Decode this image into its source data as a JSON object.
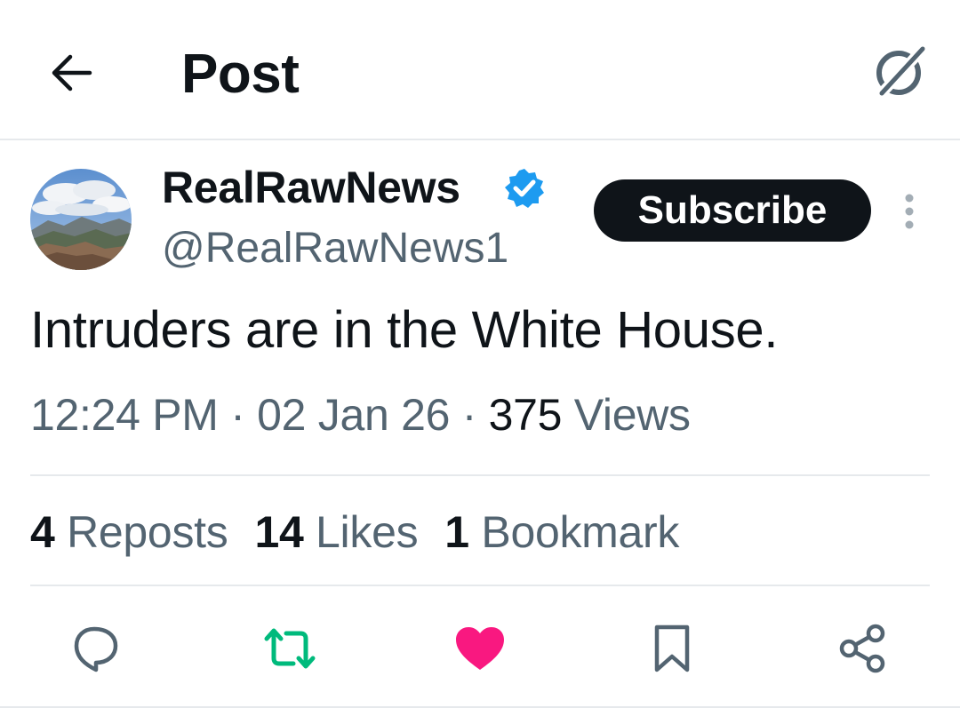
{
  "header": {
    "title": "Post"
  },
  "author": {
    "display_name": "RealRawNews",
    "handle": "@RealRawNews1",
    "verified": true,
    "subscribe_label": "Subscribe"
  },
  "post": {
    "text": "Intruders are in the White House.",
    "time": "12:24 PM",
    "date": "02 Jan 26",
    "views_count": "375",
    "views_label": "Views"
  },
  "stats": {
    "reposts": {
      "count": "4",
      "label": "Reposts"
    },
    "likes": {
      "count": "14",
      "label": "Likes"
    },
    "bookmarks": {
      "count": "1",
      "label": "Bookmark"
    }
  },
  "actions": [
    {
      "icon": "reply-icon"
    },
    {
      "icon": "repost-icon",
      "color": "#00ba7c"
    },
    {
      "icon": "heart-icon",
      "color": "#f91880",
      "liked": true
    },
    {
      "icon": "bookmark-icon"
    },
    {
      "icon": "share-icon"
    }
  ],
  "colors": {
    "text_primary": "#0f1419",
    "text_secondary": "#536471",
    "verified_blue": "#1d9bf0",
    "repost_green": "#00ba7c",
    "like_pink": "#f91880",
    "divider": "#e6e9ec"
  }
}
